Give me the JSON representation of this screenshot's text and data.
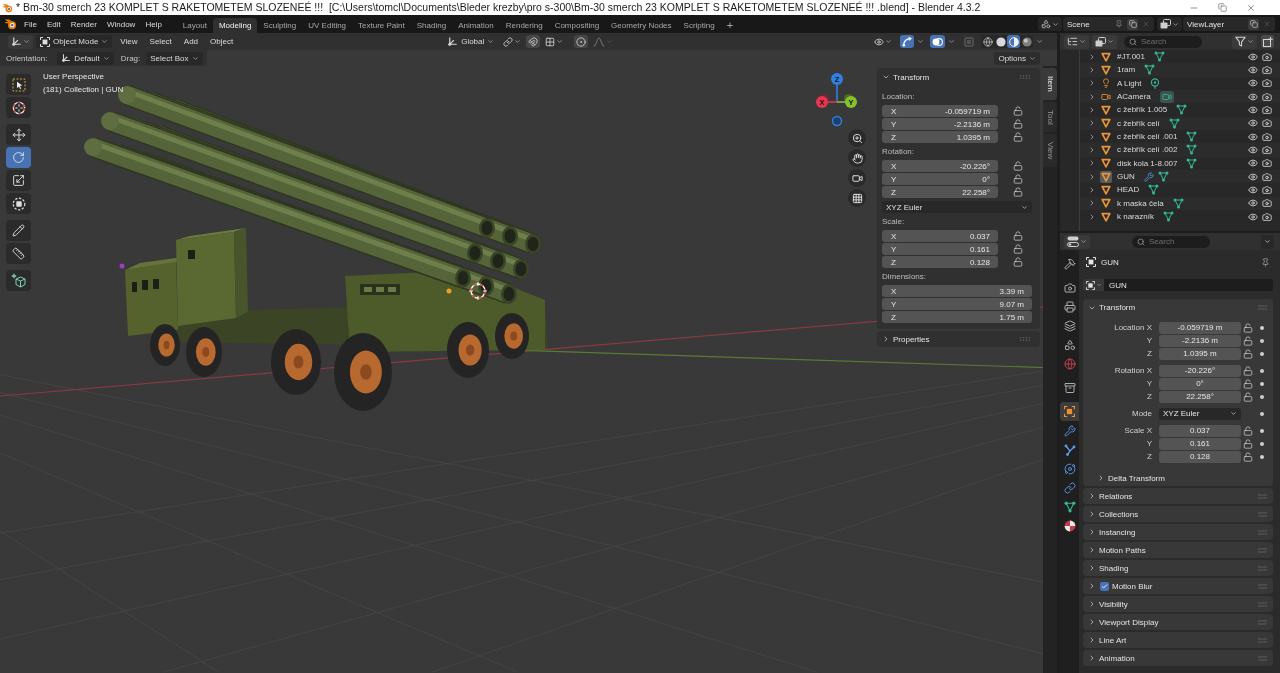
{
  "window": {
    "title": "* Bm-30 smerch 23 KOMPLET S RAKETOMETEM SLOZENEÉ !!!  [C:\\Users\\tomcl\\Documents\\Bleder krezby\\pro s-300\\Bm-30 smerch 23 KOMPLET S RAKETOMETEM SLOZENEÉ !!! .blend] - Blender 4.3.2"
  },
  "menu": [
    "File",
    "Edit",
    "Render",
    "Window",
    "Help"
  ],
  "workspaces": [
    {
      "label": "Layout",
      "selected": false
    },
    {
      "label": "Modeling",
      "selected": true
    },
    {
      "label": "Sculpting",
      "selected": false
    },
    {
      "label": "UV Editing",
      "selected": false
    },
    {
      "label": "Texture Paint",
      "selected": false
    },
    {
      "label": "Shading",
      "selected": false
    },
    {
      "label": "Animation",
      "selected": false
    },
    {
      "label": "Rendering",
      "selected": false
    },
    {
      "label": "Compositing",
      "selected": false
    },
    {
      "label": "Geometry Nodes",
      "selected": false
    },
    {
      "label": "Scripting",
      "selected": false
    }
  ],
  "add_workspace": "+",
  "scene": {
    "name": "Scene"
  },
  "view_layer": {
    "name": "ViewLayer"
  },
  "viewport": {
    "header": {
      "mode": "Object Mode",
      "menus": [
        "View",
        "Select",
        "Add",
        "Object"
      ],
      "orientation": "Global",
      "gizmos": true,
      "overlays": true,
      "shading": [
        {
          "kind": "wireframe",
          "selected": false
        },
        {
          "kind": "solid",
          "selected": false
        },
        {
          "kind": "material",
          "selected": true
        },
        {
          "kind": "rendered",
          "selected": false
        }
      ]
    },
    "tool_settings": {
      "orientation_label": "Orientation:",
      "orientation": "Default",
      "drag_label": "Drag:",
      "drag": "Select Box",
      "options": "Options"
    },
    "tool_groups": [
      {
        "tools": [
          {
            "kind": "select_box",
            "selected": false
          },
          {
            "kind": "cursor",
            "selected": false
          }
        ]
      },
      {
        "tools": [
          {
            "kind": "move",
            "selected": false
          },
          {
            "kind": "rotate",
            "selected": true
          },
          {
            "kind": "scale",
            "selected": false
          },
          {
            "kind": "transform",
            "selected": false
          }
        ]
      },
      {
        "tools": [
          {
            "kind": "annotate",
            "selected": false
          },
          {
            "kind": "measure",
            "selected": false
          }
        ]
      },
      {
        "tools": [
          {
            "kind": "add_cube",
            "selected": false
          }
        ]
      }
    ],
    "info": [
      "User Perspective",
      "(181) Collection | GUN"
    ],
    "gizmo_axes": [
      "X",
      "Y",
      "Z"
    ],
    "sidebar": {
      "tabs": [
        {
          "label": "Item",
          "selected": true
        },
        {
          "label": "Tool",
          "selected": false
        },
        {
          "label": "View",
          "selected": false
        }
      ],
      "panels": [
        {
          "title": "Transform",
          "expanded": true,
          "rows": [
            {
              "kind": "vector",
              "label": "Location:",
              "lockable": true,
              "fields": [
                {
                  "axis": "X",
                  "value": "-0.059719 m"
                },
                {
                  "axis": "Y",
                  "value": "-2.2136 m"
                },
                {
                  "axis": "Z",
                  "value": "1.0395 m"
                }
              ]
            },
            {
              "kind": "vector",
              "label": "Rotation:",
              "lockable": true,
              "fields": [
                {
                  "axis": "X",
                  "value": "-20.226°"
                },
                {
                  "axis": "Y",
                  "value": "0°"
                },
                {
                  "axis": "Z",
                  "value": "22.258°"
                }
              ]
            },
            {
              "kind": "dropdown",
              "value": "XYZ Euler"
            },
            {
              "kind": "vector",
              "label": "Scale:",
              "lockable": true,
              "fields": [
                {
                  "axis": "X",
                  "value": "0.037"
                },
                {
                  "axis": "Y",
                  "value": "0.161"
                },
                {
                  "axis": "Z",
                  "value": "0.128"
                }
              ]
            },
            {
              "kind": "vector",
              "label": "Dimensions:",
              "lockable": false,
              "fields": [
                {
                  "axis": "X",
                  "value": "3.39 m"
                },
                {
                  "axis": "Y",
                  "value": "9.07 m"
                },
                {
                  "axis": "Z",
                  "value": "1.75 m"
                }
              ]
            }
          ]
        },
        {
          "title": "Properties",
          "expanded": false
        }
      ]
    }
  },
  "outliner": {
    "search_placeholder": "Search",
    "items": [
      {
        "name": "#JT.001",
        "kind": "mesh",
        "active": false,
        "modifier": false
      },
      {
        "name": "1ram",
        "kind": "mesh",
        "active": false,
        "modifier": false
      },
      {
        "name": "A Light",
        "kind": "light",
        "active": false,
        "modifier": false
      },
      {
        "name": "ACamera",
        "kind": "camera",
        "active": false,
        "modifier": false
      },
      {
        "name": "c žebřík 1.005",
        "kind": "mesh",
        "active": false,
        "modifier": false
      },
      {
        "name": "c žebřík celí",
        "kind": "mesh",
        "active": false,
        "modifier": false
      },
      {
        "name": "c žebřík celí .001",
        "kind": "mesh",
        "active": false,
        "modifier": false
      },
      {
        "name": "c žebřík celí .002",
        "kind": "mesh",
        "active": false,
        "modifier": false
      },
      {
        "name": "disk kola 1-8.007",
        "kind": "mesh",
        "active": false,
        "modifier": false
      },
      {
        "name": "GUN",
        "kind": "mesh",
        "active": true,
        "modifier": true
      },
      {
        "name": "HEAD",
        "kind": "mesh",
        "active": false,
        "modifier": false
      },
      {
        "name": "k maska čela",
        "kind": "mesh",
        "active": false,
        "modifier": false
      },
      {
        "name": "k narazník",
        "kind": "mesh",
        "active": false,
        "modifier": false
      }
    ]
  },
  "properties": {
    "search_placeholder": "Search",
    "tab_groups": [
      {
        "tabs": [
          {
            "kind": "tool",
            "selected": false
          }
        ]
      },
      {
        "tabs": [
          {
            "kind": "render",
            "selected": false
          },
          {
            "kind": "output",
            "selected": false
          },
          {
            "kind": "view_layer",
            "selected": false
          },
          {
            "kind": "scene",
            "selected": false
          },
          {
            "kind": "world",
            "selected": false
          }
        ]
      },
      {
        "tabs": [
          {
            "kind": "collection",
            "selected": false
          }
        ]
      },
      {
        "tabs": [
          {
            "kind": "object",
            "selected": true
          },
          {
            "kind": "modifiers",
            "selected": false
          },
          {
            "kind": "particles",
            "selected": false
          },
          {
            "kind": "physics",
            "selected": false
          },
          {
            "kind": "constraints",
            "selected": false
          },
          {
            "kind": "data",
            "selected": false
          },
          {
            "kind": "material",
            "selected": false
          }
        ]
      }
    ],
    "context": "GUN",
    "name": "GUN",
    "transform": {
      "title": "Transform",
      "expanded": true,
      "groups": [
        {
          "kind": "vector",
          "rows": [
            {
              "label": "Location X",
              "value": "-0.059719 m"
            },
            {
              "label": "Y",
              "value": "-2.2136 m"
            },
            {
              "label": "Z",
              "value": "1.0395 m"
            }
          ]
        },
        {
          "kind": "vector",
          "rows": [
            {
              "label": "Rotation X",
              "value": "-20.226°"
            },
            {
              "label": "Y",
              "value": "0°"
            },
            {
              "label": "Z",
              "value": "22.258°"
            }
          ]
        },
        {
          "kind": "dropdown",
          "rows": [
            {
              "label": "Mode",
              "value": "XYZ Euler"
            }
          ]
        },
        {
          "kind": "vector",
          "rows": [
            {
              "label": "Scale X",
              "value": "0.037"
            },
            {
              "label": "Y",
              "value": "0.161"
            },
            {
              "label": "Z",
              "value": "0.128"
            }
          ]
        }
      ],
      "subpanels": [
        {
          "title": "Delta Transform",
          "expanded": false
        }
      ]
    },
    "panels": [
      {
        "title": "Relations",
        "kind": "plain",
        "expanded": false
      },
      {
        "title": "Collections",
        "kind": "plain",
        "expanded": false
      },
      {
        "title": "Instancing",
        "kind": "plain",
        "expanded": false
      },
      {
        "title": "Motion Paths",
        "kind": "plain",
        "expanded": false
      },
      {
        "title": "Shading",
        "kind": "plain",
        "expanded": false
      },
      {
        "title": "Motion Blur",
        "kind": "toggle",
        "checked": true,
        "expanded": false
      },
      {
        "title": "Visibility",
        "kind": "plain",
        "expanded": false
      },
      {
        "title": "Viewport Display",
        "kind": "plain",
        "expanded": false
      },
      {
        "title": "Line Art",
        "kind": "plain",
        "expanded": false
      },
      {
        "title": "Animation",
        "kind": "plain",
        "expanded": false
      }
    ]
  }
}
